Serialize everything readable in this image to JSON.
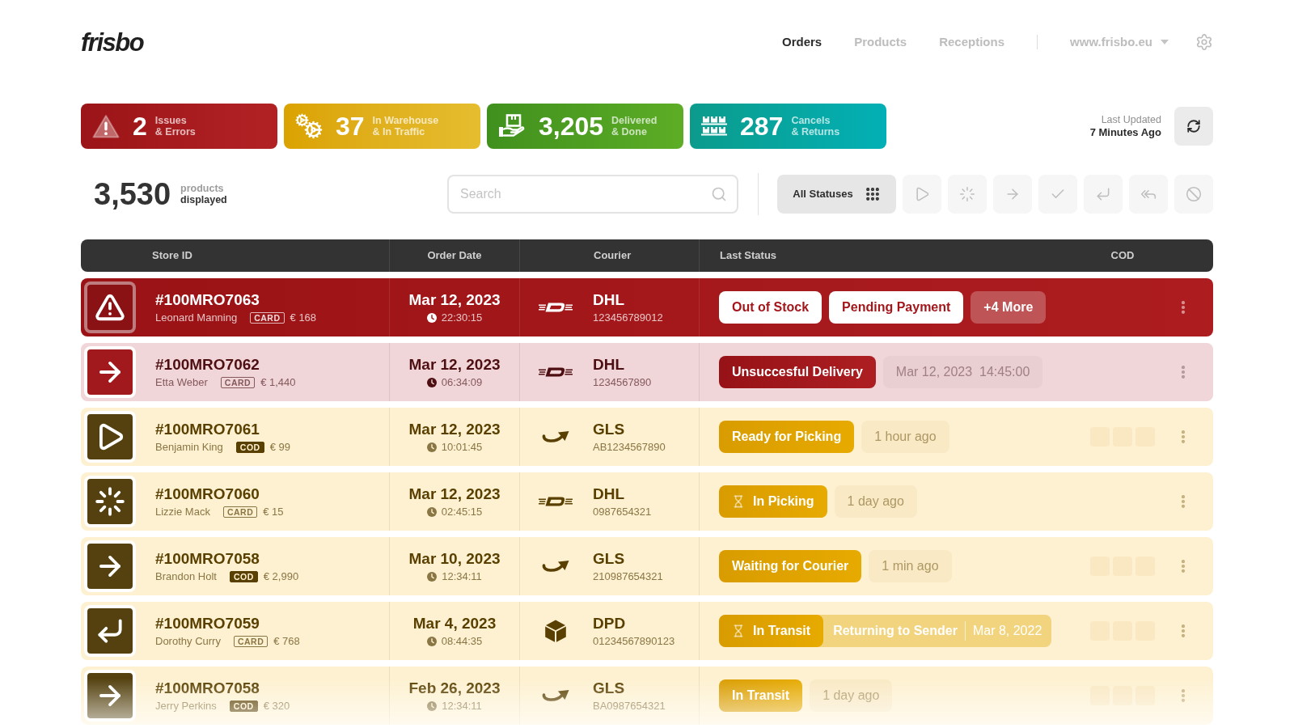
{
  "header": {
    "logo": "frisbo",
    "nav": [
      {
        "label": "Orders",
        "selected": true
      },
      {
        "label": "Products",
        "selected": false
      },
      {
        "label": "Receptions",
        "selected": false
      }
    ],
    "store": "www.frisbo.eu"
  },
  "stats": [
    {
      "kind": "issues",
      "count": "2",
      "label": "Issues",
      "sublabel": "& Errors"
    },
    {
      "kind": "warehouse",
      "count": "37",
      "label": "In Warehouse",
      "sublabel": "& In Traffic"
    },
    {
      "kind": "delivered",
      "count": "3,205",
      "label": "Delivered",
      "sublabel": "& Done"
    },
    {
      "kind": "cancels",
      "count": "287",
      "label": "Cancels",
      "sublabel": "& Returns"
    }
  ],
  "last_updated": {
    "label": "Last Updated",
    "value": "7 Minutes Ago"
  },
  "summary": {
    "count": "3,530",
    "label": "products",
    "sublabel": "displayed"
  },
  "search": {
    "placeholder": "Search"
  },
  "filters": [
    {
      "kind": "all",
      "label": "All Statuses",
      "selected": true
    },
    {
      "kind": "ready",
      "selected": false
    },
    {
      "kind": "picking",
      "selected": false
    },
    {
      "kind": "outbound",
      "selected": false
    },
    {
      "kind": "delivered",
      "selected": false
    },
    {
      "kind": "returning",
      "selected": false
    },
    {
      "kind": "returned",
      "selected": false
    },
    {
      "kind": "cancelled",
      "selected": false
    }
  ],
  "table": {
    "columns": [
      "Store ID",
      "Order Date",
      "Courier",
      "Last Status",
      "COD"
    ],
    "rows": [
      {
        "kind": "alert",
        "thumbnail": {
          "kind": "issue"
        },
        "order_id": "#100MRO7063",
        "customer": "Leonard Manning",
        "payment": {
          "kind": "card",
          "label": "CARD"
        },
        "amount": "€ 168",
        "date": "Mar 12, 2023",
        "time": "22:30:15",
        "courier": {
          "kind": "dhl",
          "name": "DHL",
          "tracking": "123456789012"
        },
        "statuses": [
          {
            "kind": "tag",
            "label": "Out of Stock"
          },
          {
            "kind": "tag",
            "label": "Pending Payment"
          },
          {
            "kind": "more",
            "label": "+4 More"
          }
        ],
        "cod_placeholder": false
      },
      {
        "kind": "failed",
        "thumbnail": {
          "kind": "outbound"
        },
        "order_id": "#100MRO7062",
        "customer": "Etta Weber",
        "payment": {
          "kind": "card",
          "label": "CARD"
        },
        "amount": "€ 1,440",
        "date": "Mar 12, 2023",
        "time": "06:34:09",
        "courier": {
          "kind": "dhl",
          "name": "DHL",
          "tracking": "1234567890"
        },
        "statuses": [
          {
            "kind": "failed",
            "label": "Unsuccesful Delivery"
          },
          {
            "kind": "stamp",
            "label": "Mar 12, 2023  14:45:00"
          }
        ],
        "cod_placeholder": false
      },
      {
        "kind": "open",
        "thumbnail": {
          "kind": "ready"
        },
        "order_id": "#100MRO7061",
        "customer": "Benjamin King",
        "payment": {
          "kind": "cod",
          "label": "COD"
        },
        "amount": "€ 99",
        "date": "Mar 12, 2023",
        "time": "10:01:45",
        "courier": {
          "kind": "gls",
          "name": "GLS",
          "tracking": "AB1234567890"
        },
        "statuses": [
          {
            "kind": "stage",
            "label": "Ready for Picking",
            "waiting": false
          },
          {
            "kind": "stamp",
            "label": "1 hour ago"
          }
        ],
        "cod_placeholder": true
      },
      {
        "kind": "open",
        "thumbnail": {
          "kind": "picking"
        },
        "order_id": "#100MRO7060",
        "customer": "Lizzie Mack",
        "payment": {
          "kind": "card",
          "label": "CARD"
        },
        "amount": "€ 15",
        "date": "Mar 12, 2023",
        "time": "02:45:15",
        "courier": {
          "kind": "dhl",
          "name": "DHL",
          "tracking": "0987654321"
        },
        "statuses": [
          {
            "kind": "stage",
            "label": "In Picking",
            "waiting": true
          },
          {
            "kind": "stamp",
            "label": "1 day ago"
          }
        ],
        "cod_placeholder": false
      },
      {
        "kind": "open",
        "thumbnail": {
          "kind": "outbound"
        },
        "order_id": "#100MRO7058",
        "customer": "Brandon Holt",
        "payment": {
          "kind": "cod",
          "label": "COD"
        },
        "amount": "€ 2,990",
        "date": "Mar 10, 2023",
        "time": "12:34:11",
        "courier": {
          "kind": "gls",
          "name": "GLS",
          "tracking": "210987654321"
        },
        "statuses": [
          {
            "kind": "stage",
            "label": "Waiting for Courier",
            "waiting": false
          },
          {
            "kind": "stamp",
            "label": "1 min ago"
          }
        ],
        "cod_placeholder": true
      },
      {
        "kind": "open",
        "thumbnail": {
          "kind": "returning"
        },
        "order_id": "#100MRO7059",
        "customer": "Dorothy Curry",
        "payment": {
          "kind": "card",
          "label": "CARD"
        },
        "amount": "€ 768",
        "date": "Mar 4, 2023",
        "time": "08:44:35",
        "courier": {
          "kind": "dpd",
          "name": "DPD",
          "tracking": "01234567890123"
        },
        "statuses": [
          {
            "kind": "stage",
            "label": "In Transit",
            "waiting": true,
            "return": {
              "label": "Returning to Sender",
              "date": "Mar 8, 2022"
            }
          }
        ],
        "cod_placeholder": true
      },
      {
        "kind": "open",
        "thumbnail": {
          "kind": "outbound"
        },
        "order_id": "#100MRO7058",
        "customer": "Jerry Perkins",
        "payment": {
          "kind": "cod",
          "label": "COD"
        },
        "amount": "€ 320",
        "date": "Feb 26, 2023",
        "time": "12:34:11",
        "courier": {
          "kind": "gls",
          "name": "GLS",
          "tracking": "BA0987654321"
        },
        "statuses": [
          {
            "kind": "stage",
            "label": "In Transit",
            "waiting": false
          },
          {
            "kind": "stamp",
            "label": "1 day ago"
          }
        ],
        "cod_placeholder": true
      }
    ]
  }
}
